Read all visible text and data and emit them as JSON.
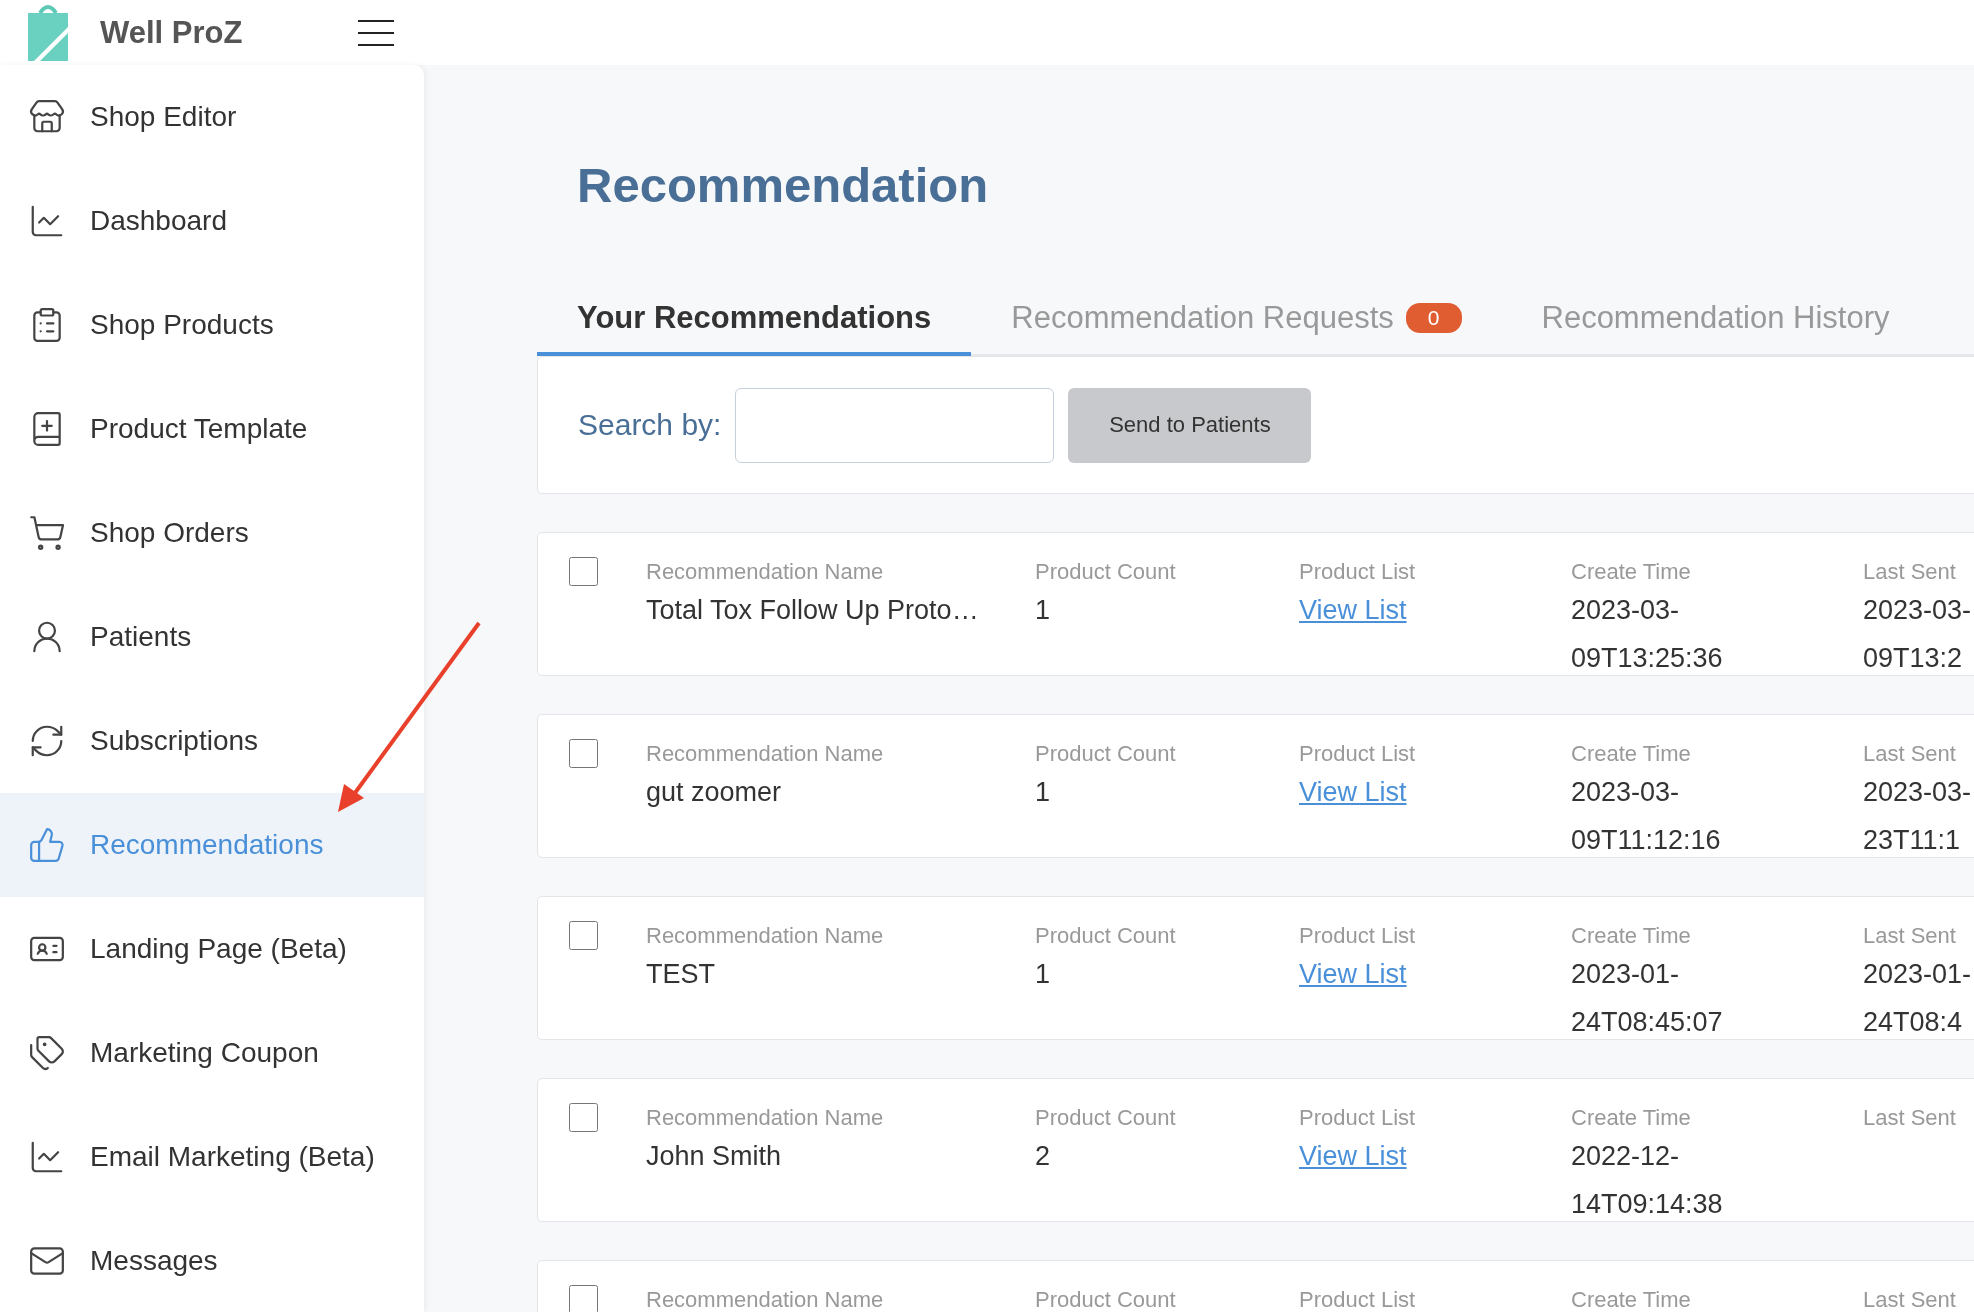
{
  "brand": {
    "name": "Well ProZ"
  },
  "sidebar": {
    "items": [
      {
        "label": "Shop Editor",
        "selected": false
      },
      {
        "label": "Dashboard",
        "selected": false
      },
      {
        "label": "Shop Products",
        "selected": false
      },
      {
        "label": "Product Template",
        "selected": false
      },
      {
        "label": "Shop Orders",
        "selected": false
      },
      {
        "label": "Patients",
        "selected": false
      },
      {
        "label": "Subscriptions",
        "selected": false
      },
      {
        "label": "Recommendations",
        "selected": true
      },
      {
        "label": "Landing Page (Beta)",
        "selected": false
      },
      {
        "label": "Marketing Coupon",
        "selected": false
      },
      {
        "label": "Email Marketing (Beta)",
        "selected": false
      },
      {
        "label": "Messages",
        "selected": false
      }
    ]
  },
  "page_title": "Recommendation",
  "tabs": [
    {
      "label": "Your Recommendations",
      "selected": true
    },
    {
      "label": "Recommendation Requests",
      "selected": false,
      "badge": "0"
    },
    {
      "label": "Recommendation History",
      "selected": false
    }
  ],
  "search": {
    "label": "Search by:",
    "button": "Send to Patients"
  },
  "rows": [
    {
      "checked": false,
      "headers": [
        "Recommendation Name",
        "Product Count",
        "Product List",
        "Create Time",
        "Last Sent"
      ],
      "name": "Total Tox Follow Up Proto…",
      "count": "1",
      "link": "View List",
      "created": "2023-03-09T13:25:36",
      "last_sent": "2023-03-09T13:2"
    },
    {
      "checked": false,
      "headers": [
        "Recommendation Name",
        "Product Count",
        "Product List",
        "Create Time",
        "Last Sent"
      ],
      "name": "gut zoomer",
      "count": "1",
      "link": "View List",
      "created": "2023-03-09T11:12:16",
      "last_sent": "2023-03-23T11:1"
    },
    {
      "checked": false,
      "headers": [
        "Recommendation Name",
        "Product Count",
        "Product List",
        "Create Time",
        "Last Sent"
      ],
      "name": "TEST",
      "count": "1",
      "link": "View List",
      "created": "2023-01-24T08:45:07",
      "last_sent": "2023-01-24T08:4"
    },
    {
      "checked": false,
      "headers": [
        "Recommendation Name",
        "Product Count",
        "Product List",
        "Create Time",
        "Last Sent"
      ],
      "name": "John Smith",
      "count": "2",
      "link": "View List",
      "created": "2022-12-14T09:14:38"
    },
    {
      "checked": false,
      "headers": [
        "Recommendation Name",
        "Product Count",
        "Product List",
        "Create Time",
        "Last Sent"
      ]
    }
  ]
}
